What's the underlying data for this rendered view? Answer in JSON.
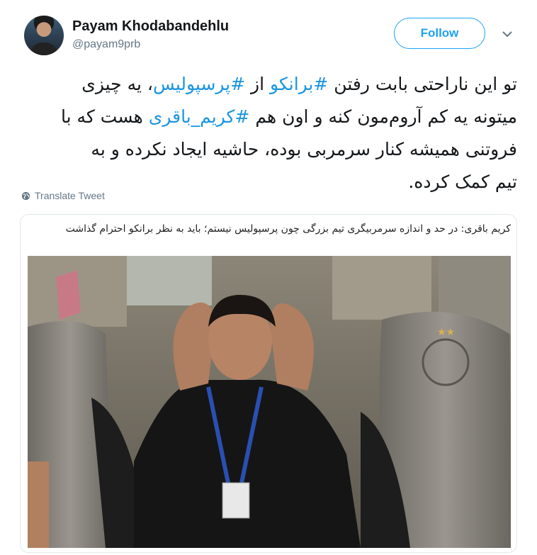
{
  "user": {
    "name": "Payam Khodabandehlu",
    "handle": "@payam9prb"
  },
  "follow_button": {
    "label": "Follow"
  },
  "tweet": {
    "lines": [
      [
        {
          "t": "تو این ناراحتی بابت رفتن ",
          "tag": false
        },
        {
          "t": "#برانکو",
          "tag": true
        },
        {
          "t": " از ",
          "tag": false
        },
        {
          "t": "#پرسپولیس",
          "tag": true
        },
        {
          "t": "، یه چیزی",
          "tag": false
        }
      ],
      [
        {
          "t": "میتونه یه کم آروم‌مون کنه و اون هم ",
          "tag": false
        },
        {
          "t": "#کریم_باقری",
          "tag": true
        },
        {
          "t": " هست که با",
          "tag": false
        }
      ],
      [
        {
          "t": "فروتنی همیشه کنار سرمربی بوده، حاشیه ایجاد نکرده و به",
          "tag": false
        }
      ],
      [
        {
          "t": "تیم کمک کرده.",
          "tag": false
        }
      ]
    ]
  },
  "translate": {
    "label": "Translate Tweet"
  },
  "card": {
    "title": "کریم باقری: در حد و اندازه سرمربیگری تیم بزرگی چون پرسپولیس نیستم؛ باید به نظر برانکو احترام گذاشت"
  },
  "colors": {
    "accent": "#1da1f2",
    "hashtag": "#1b95e0",
    "muted": "#657786"
  },
  "icons": {
    "chevron": "chevron-down-icon",
    "globe": "globe-icon"
  }
}
